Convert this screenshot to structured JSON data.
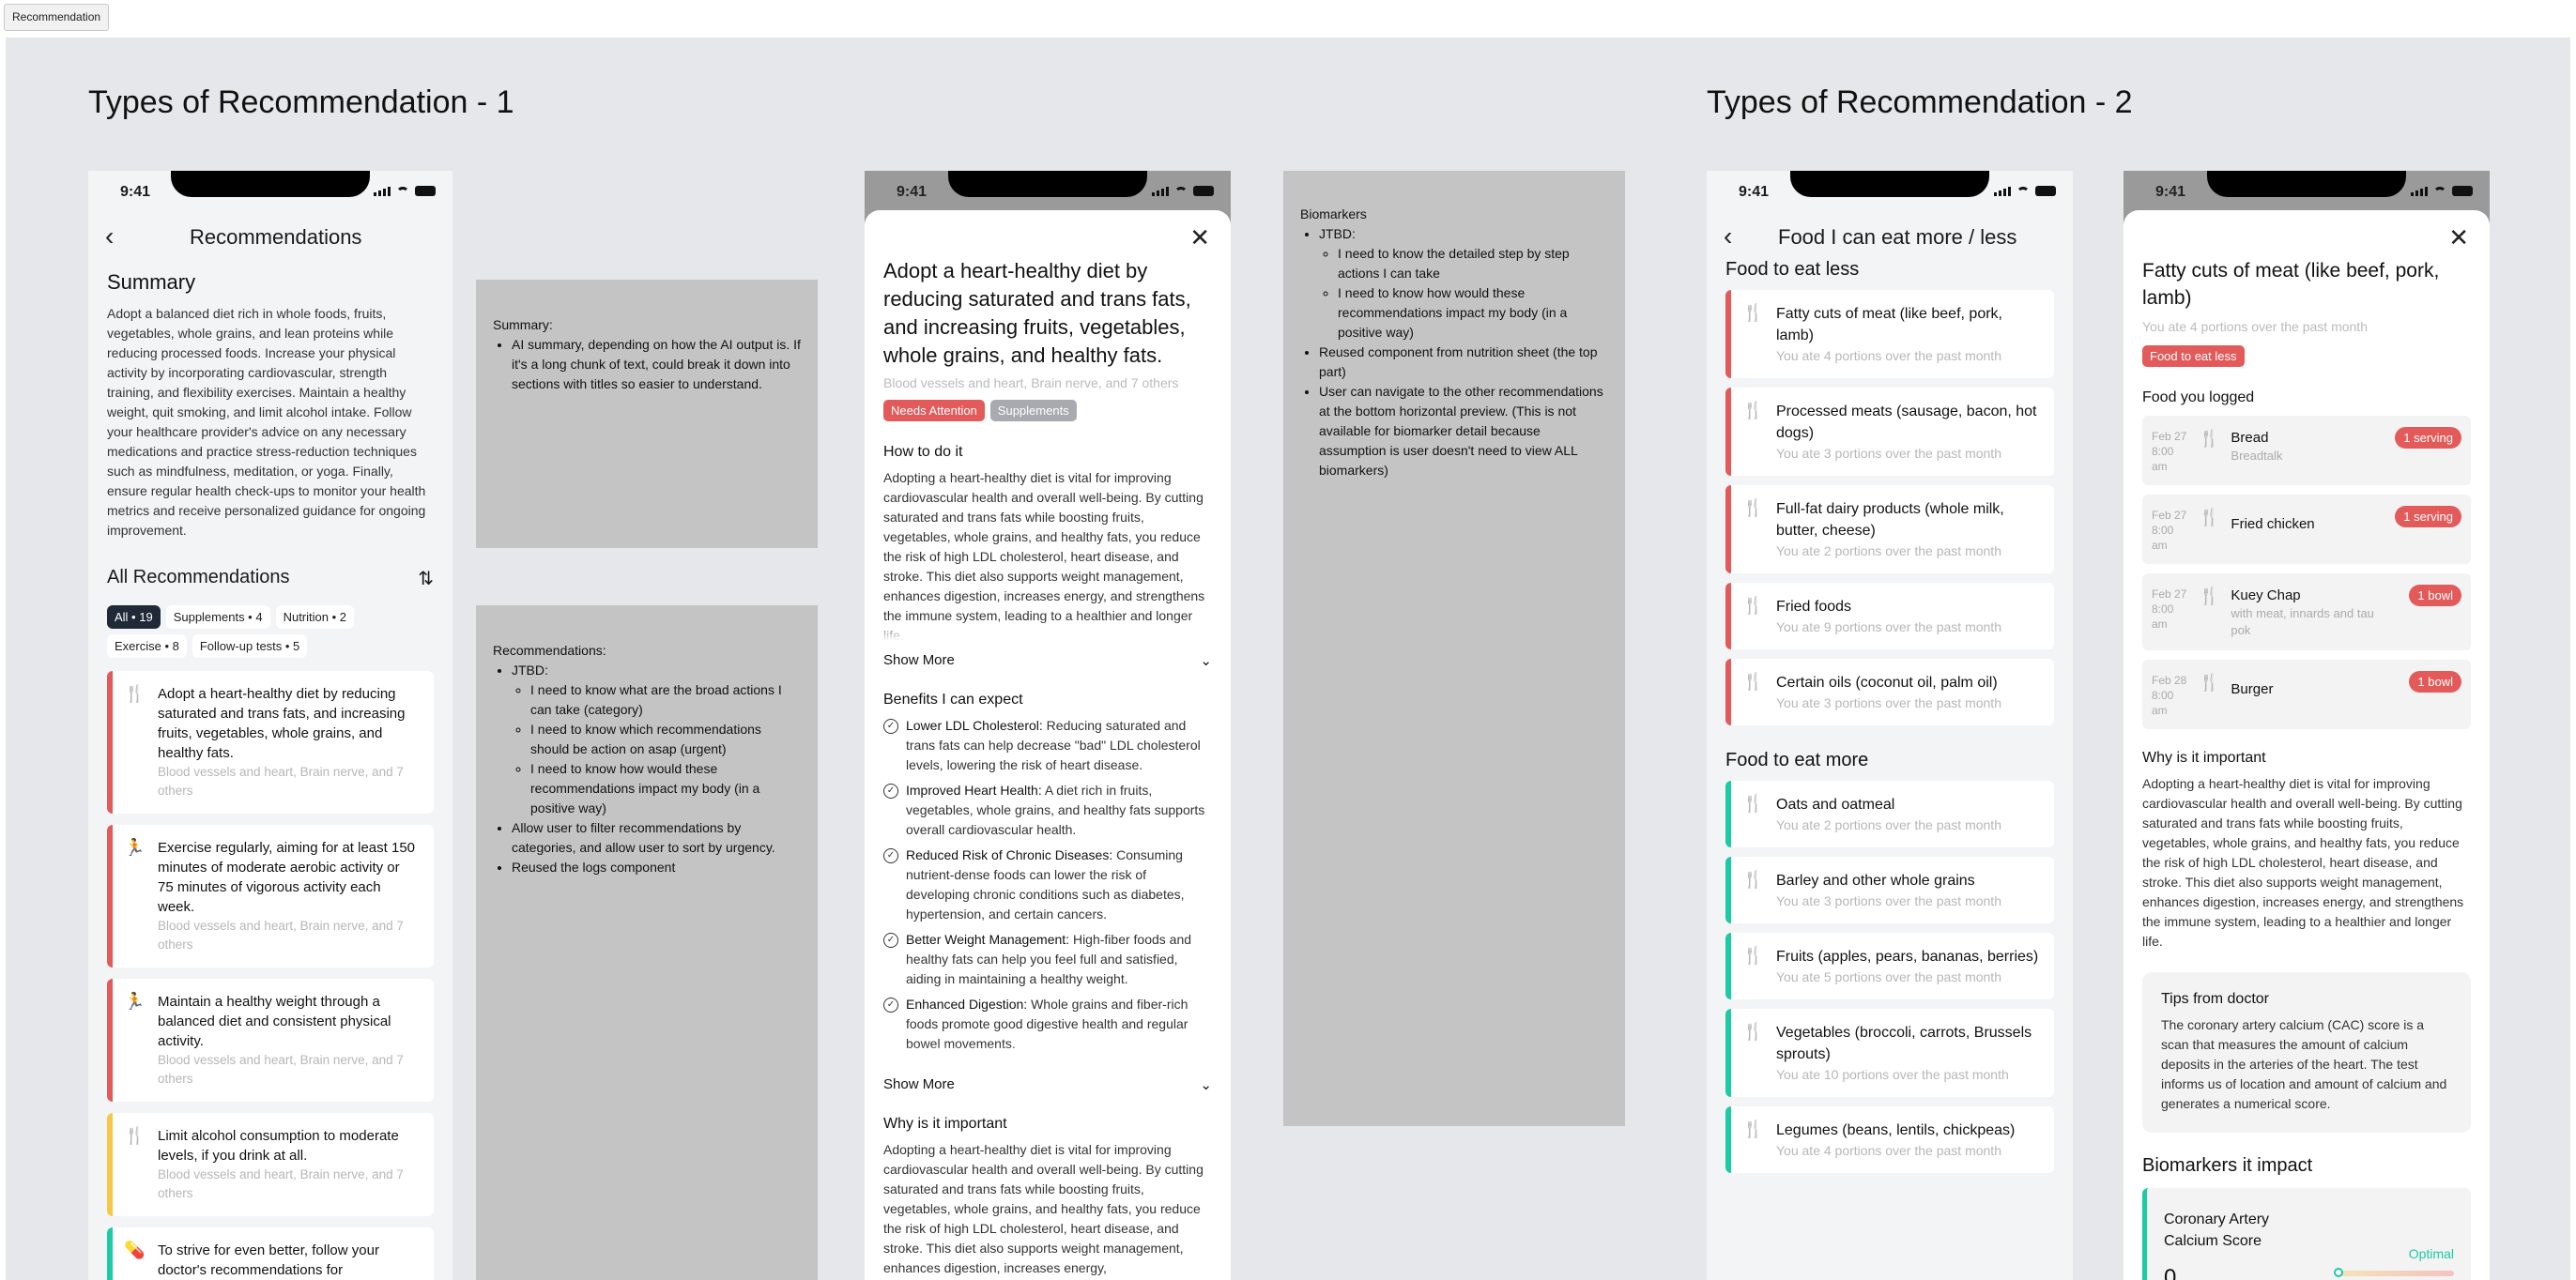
{
  "tab": "Recommendation",
  "titles": {
    "left": "Types of Recommendation - 1",
    "right": "Types of Recommendation - 2"
  },
  "status": {
    "time": "9:41"
  },
  "colors": {
    "red": "#e25a5a",
    "yellow": "#f5c84a",
    "teal": "#1ccaa4",
    "note": "#c4c4c4",
    "canvas": "#e6e7ea"
  },
  "s1": {
    "nav_title": "Recommendations",
    "summary_title": "Summary",
    "summary": "Adopt a balanced diet rich in whole foods, fruits, vegetables, whole grains, and lean proteins while reducing processed foods. Increase your physical activity by incorporating cardiovascular, strength training, and flexibility exercises. Maintain a healthy weight, quit smoking, and limit alcohol intake. Follow your healthcare provider's advice on any necessary medications and practice stress-reduction techniques such as mindfulness, meditation, or yoga. Finally, ensure regular health check-ups to monitor your health metrics and receive personalized guidance for ongoing improvement.",
    "all_title": "All Recommendations",
    "chips": [
      "All • 19",
      "Supplements • 4",
      "Nutrition • 2",
      "Exercise • 8",
      "Follow-up tests • 5"
    ],
    "cards": [
      {
        "icon": "fork-knife-icon",
        "text": "Adopt a heart-healthy diet by reducing saturated and trans fats, and increasing fruits, vegetables, whole grains, and healthy fats.",
        "sub": "Blood vessels and heart, Brain nerve, and 7 others",
        "color": "#e25a5a"
      },
      {
        "icon": "running-icon",
        "text": "Exercise regularly, aiming for at least 150 minutes of moderate aerobic activity or 75 minutes of vigorous activity each week.",
        "sub": "Blood vessels and heart, Brain nerve, and 7 others",
        "color": "#e25a5a"
      },
      {
        "icon": "running-icon",
        "text": "Maintain a healthy weight through a balanced diet and consistent physical activity.",
        "sub": "Blood vessels and heart, Brain nerve, and 7 others",
        "color": "#e25a5a"
      },
      {
        "icon": "fork-knife-icon",
        "text": "Limit alcohol consumption to moderate levels, if you drink at all.",
        "sub": "Blood vessels and heart, Brain nerve, and 7 others",
        "color": "#f5c84a"
      },
      {
        "icon": "pill-icon",
        "text": "To strive for even better, follow your doctor's recommendations for cholesterol-",
        "sub": "",
        "color": "#1ccaa4"
      }
    ]
  },
  "note1": {
    "title": "Summary:",
    "items": [
      "AI summary, depending on how the AI output is. If it's a long chunk of text, could break it down into sections with titles so easier to understand."
    ]
  },
  "note2": {
    "title": "Recommendations:",
    "jtbd": "JTBD:",
    "sub": [
      "I need to know what are the broad actions I can take (category)",
      "I need to know which recommendations should be action on asap (urgent)",
      "I need to know how would these recommendations impact my body (in a positive way)"
    ],
    "items": [
      "Allow user to filter recommendations by categories, and allow user to sort by urgency.",
      "Reused the logs component"
    ]
  },
  "note3": {
    "title": "Biomarkers",
    "jtbd": "JTBD:",
    "sub": [
      "I need to know the detailed step by step actions I can take",
      "I need to know how would these recommendations impact my body (in a positive way)"
    ],
    "items": [
      "Reused component from nutrition sheet (the top part)",
      "User can navigate to the other recommendations at the bottom horizontal preview. (This is not available for biomarker detail because assumption is user doesn't need to view ALL biomarkers)"
    ]
  },
  "s2": {
    "title": "Adopt a heart-healthy diet by reducing saturated and trans fats, and increasing fruits, vegetables, whole grains, and healthy fats.",
    "subtitle": "Blood vessels and heart, Brain nerve, and 7 others",
    "tags": [
      "Needs Attention",
      "Supplements"
    ],
    "how_title": "How to do it",
    "how": "Adopting a heart-healthy diet is vital for improving cardiovascular health and overall well-being. By cutting saturated and trans fats while boosting fruits, vegetables, whole grains, and healthy fats, you reduce the risk of high LDL cholesterol, heart disease, and stroke. This diet also supports weight management, enhances digestion, increases energy, and strengthens the immune system, leading to a healthier and longer life.",
    "show_more": "Show More",
    "benefits_title": "Benefits I can expect",
    "benefits": [
      {
        "b": "Lower LDL Cholesterol:",
        "t": " Reducing saturated and trans fats can help decrease \"bad\" LDL cholesterol levels, lowering the risk of heart disease."
      },
      {
        "b": "Improved Heart Health:",
        "t": " A diet rich in fruits, vegetables, whole grains, and healthy fats supports overall cardiovascular health."
      },
      {
        "b": "Reduced Risk of Chronic Diseases:",
        "t": " Consuming nutrient-dense foods can lower the risk of developing chronic conditions such as diabetes, hypertension, and certain cancers."
      },
      {
        "b": "Better Weight Management:",
        "t": " High-fiber foods and healthy fats can help you feel full and satisfied, aiding in maintaining a healthy weight."
      },
      {
        "b": "Enhanced Digestion:",
        "t": " Whole grains and fiber-rich foods promote good digestive health and regular bowel movements."
      }
    ],
    "show_more2": "Show More",
    "why_title": "Why is it important",
    "why": "Adopting a heart-healthy diet is vital for improving cardiovascular health and overall well-being. By cutting saturated and trans fats while boosting fruits, vegetables, whole grains, and healthy fats, you reduce the risk of high LDL cholesterol, heart disease, and stroke. This diet also supports weight management, enhances digestion, increases energy,"
  },
  "s3": {
    "nav_title": "Food I can eat more / less",
    "less_title": "Food to eat less",
    "less": [
      {
        "t": "Fatty cuts of meat (like beef, pork, lamb)",
        "s": "You ate 4 portions over the past month"
      },
      {
        "t": "Processed meats (sausage, bacon, hot dogs)",
        "s": "You ate 3 portions over the past month"
      },
      {
        "t": "Full-fat dairy products (whole milk, butter, cheese)",
        "s": "You ate 2 portions over the past month"
      },
      {
        "t": "Fried foods",
        "s": "You ate 9 portions over the past month"
      },
      {
        "t": "Certain oils (coconut oil, palm oil)",
        "s": "You ate 3 portions over the past month"
      }
    ],
    "more_title": "Food to eat more",
    "more": [
      {
        "t": "Oats and oatmeal",
        "s": "You ate 2 portions over the past month"
      },
      {
        "t": "Barley and other whole grains",
        "s": "You ate 3 portions over the past month"
      },
      {
        "t": "Fruits (apples, pears, bananas, berries)",
        "s": "You ate 5 portions over the past month"
      },
      {
        "t": "Vegetables (broccoli, carrots, Brussels sprouts)",
        "s": "You ate 10 portions over the past month"
      },
      {
        "t": "Legumes (beans, lentils, chickpeas)",
        "s": "You ate 4 portions over the past month"
      }
    ]
  },
  "s4": {
    "title": "Fatty cuts of meat (like beef, pork, lamb)",
    "subtitle": "You ate 4 portions over the past month",
    "tag": "Food to eat less",
    "logged_title": "Food you logged",
    "logs": [
      {
        "d": "Feb 27",
        "tm": "8:00 am",
        "n": "Bread",
        "s": "Breadtalk",
        "q": "1 serving"
      },
      {
        "d": "Feb 27",
        "tm": "8:00 am",
        "n": "Fried chicken",
        "s": "",
        "q": "1 serving"
      },
      {
        "d": "Feb 27",
        "tm": "8:00 am",
        "n": "Kuey Chap",
        "s": "with meat, innards and tau pok",
        "q": "1 bowl"
      },
      {
        "d": "Feb 28",
        "tm": "8:00 am",
        "n": "Burger",
        "s": "",
        "q": "1 bowl"
      }
    ],
    "why_title": "Why is it important",
    "why": "Adopting a heart-healthy diet is vital for improving cardiovascular health and overall well-being. By cutting saturated and trans fats while boosting fruits, vegetables, whole grains, and healthy fats, you reduce the risk of high LDL cholesterol, heart disease, and stroke. This diet also supports weight management, enhances digestion, increases energy, and strengthens the immune system, leading to a healthier and longer life.",
    "tips_title": "Tips from doctor",
    "tips": "The coronary artery calcium (CAC) score is a scan that measures the amount of calcium deposits in the arteries of the heart. The test informs us of location and amount of calcium and generates a numerical score.",
    "bio_title": "Biomarkers it impact",
    "bio_name": "Coronary Artery Calcium Score",
    "bio_value": "0",
    "bio_status": "Optimal",
    "bio_tick": "1"
  }
}
